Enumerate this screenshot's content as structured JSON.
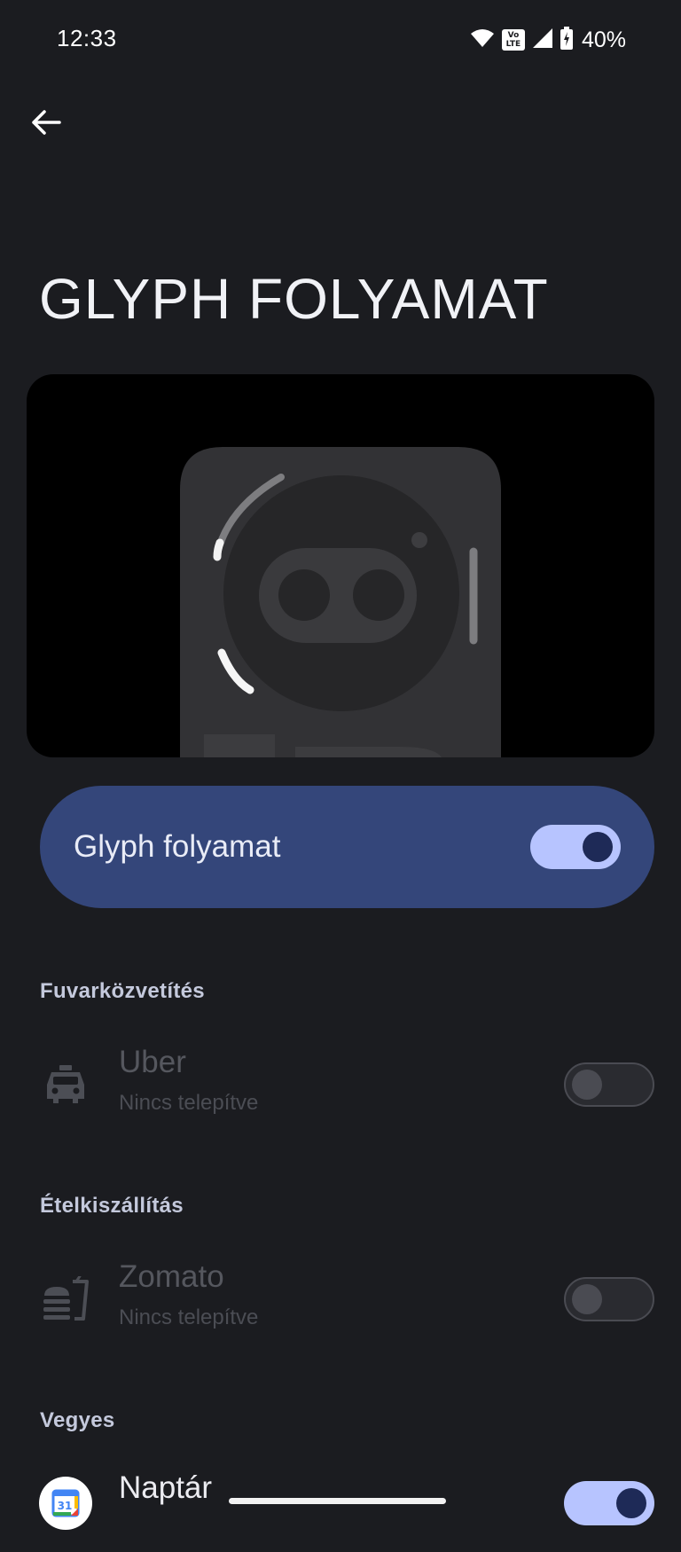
{
  "status_bar": {
    "time": "12:33",
    "volte_label": "Vo LTE",
    "battery_percent": "40%",
    "icons": [
      "wifi-icon",
      "volte-icon",
      "signal-icon",
      "battery-charging-icon"
    ]
  },
  "header": {
    "back_icon": "arrow-back-icon",
    "title": "GLYPH FOLYAMAT"
  },
  "main_toggle": {
    "label": "Glyph folyamat",
    "state": "on"
  },
  "sections": [
    {
      "title": "Fuvarközvetítés",
      "apps": [
        {
          "name": "Uber",
          "status": "Nincs telepítve",
          "icon": "taxi-icon",
          "enabled": false,
          "toggle": "off"
        }
      ]
    },
    {
      "title": "Ételkiszállítás",
      "apps": [
        {
          "name": "Zomato",
          "status": "Nincs telepítve",
          "icon": "food-delivery-icon",
          "enabled": false,
          "toggle": "off"
        }
      ]
    },
    {
      "title": "Vegyes",
      "apps": [
        {
          "name": "Naptár",
          "icon": "google-calendar-icon",
          "calendar_day": "31",
          "enabled": true,
          "toggle": "on"
        }
      ]
    }
  ],
  "colors": {
    "background": "#1b1c20",
    "card": "#34467a",
    "accent": "#b7c4ff",
    "knob": "#1e2a57"
  }
}
